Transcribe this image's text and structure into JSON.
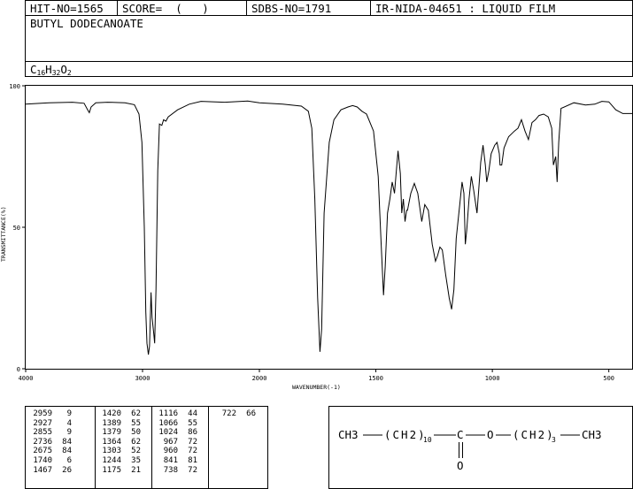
{
  "header": {
    "hit_no": "HIT-NO=1565",
    "score": "SCORE=  (   )",
    "sdbs_no": "SDBS-NO=1791",
    "ir_id": "IR-NIDA-04651 : LIQUID FILM"
  },
  "compound": {
    "name": "BUTYL DODECANOATE",
    "formula_parts": [
      "C",
      "16",
      "H",
      "32",
      "O",
      "2"
    ]
  },
  "chart_data": {
    "type": "line",
    "xlabel": "WAVENUMBER(-1)",
    "ylabel": "TRANSMITTANCE(%)",
    "xlim": [
      4000,
      400
    ],
    "ylim": [
      0,
      100
    ],
    "xticks": [
      "4000",
      "3000",
      "2000",
      "1500",
      "1000",
      "500"
    ],
    "xtick_values": [
      4000,
      3000,
      2000,
      1500,
      1000,
      500
    ],
    "yticks": [
      "0",
      "50",
      "100"
    ],
    "ytick_values": [
      0,
      50,
      100
    ],
    "grid": false,
    "series": [
      {
        "points": [
          [
            4000,
            93.5
          ],
          [
            3800,
            94
          ],
          [
            3600,
            94.2
          ],
          [
            3500,
            93.8
          ],
          [
            3470,
            91.5
          ],
          [
            3455,
            90.5
          ],
          [
            3440,
            92.5
          ],
          [
            3400,
            94
          ],
          [
            3300,
            94.2
          ],
          [
            3150,
            94
          ],
          [
            3070,
            93.3
          ],
          [
            3030,
            90
          ],
          [
            3005,
            80
          ],
          [
            2985,
            50
          ],
          [
            2972,
            20
          ],
          [
            2962,
            9
          ],
          [
            2950,
            5
          ],
          [
            2940,
            8
          ],
          [
            2932,
            20
          ],
          [
            2927,
            27
          ],
          [
            2918,
            18
          ],
          [
            2905,
            13
          ],
          [
            2896,
            9
          ],
          [
            2885,
            28
          ],
          [
            2870,
            70
          ],
          [
            2855,
            86.5
          ],
          [
            2835,
            86
          ],
          [
            2820,
            88
          ],
          [
            2800,
            87.5
          ],
          [
            2780,
            89
          ],
          [
            2700,
            91.5
          ],
          [
            2600,
            93.5
          ],
          [
            2500,
            94.5
          ],
          [
            2300,
            94.2
          ],
          [
            2100,
            94.6
          ],
          [
            2000,
            94
          ],
          [
            1900,
            93.5
          ],
          [
            1820,
            92.8
          ],
          [
            1790,
            91
          ],
          [
            1775,
            85
          ],
          [
            1762,
            60
          ],
          [
            1750,
            25
          ],
          [
            1740,
            6
          ],
          [
            1733,
            14
          ],
          [
            1722,
            55
          ],
          [
            1700,
            80
          ],
          [
            1680,
            88
          ],
          [
            1650,
            91.5
          ],
          [
            1620,
            92.5
          ],
          [
            1600,
            93
          ],
          [
            1580,
            92.5
          ],
          [
            1560,
            91
          ],
          [
            1540,
            90
          ],
          [
            1510,
            84
          ],
          [
            1490,
            68
          ],
          [
            1478,
            45
          ],
          [
            1467,
            26
          ],
          [
            1460,
            36
          ],
          [
            1450,
            55
          ],
          [
            1440,
            60
          ],
          [
            1430,
            66
          ],
          [
            1420,
            62
          ],
          [
            1412,
            70
          ],
          [
            1405,
            77
          ],
          [
            1395,
            69
          ],
          [
            1389,
            55
          ],
          [
            1382,
            60
          ],
          [
            1375,
            52
          ],
          [
            1368,
            56
          ],
          [
            1364,
            56
          ],
          [
            1350,
            62
          ],
          [
            1335,
            65.5
          ],
          [
            1320,
            62
          ],
          [
            1303,
            52
          ],
          [
            1290,
            58
          ],
          [
            1275,
            56
          ],
          [
            1258,
            44
          ],
          [
            1244,
            38
          ],
          [
            1235,
            40
          ],
          [
            1225,
            43
          ],
          [
            1215,
            42
          ],
          [
            1200,
            33
          ],
          [
            1185,
            25
          ],
          [
            1175,
            21
          ],
          [
            1165,
            28
          ],
          [
            1155,
            46
          ],
          [
            1140,
            58
          ],
          [
            1130,
            66
          ],
          [
            1122,
            62
          ],
          [
            1116,
            44
          ],
          [
            1110,
            49
          ],
          [
            1100,
            60
          ],
          [
            1090,
            68
          ],
          [
            1080,
            63
          ],
          [
            1066,
            55
          ],
          [
            1058,
            64
          ],
          [
            1050,
            73
          ],
          [
            1040,
            79
          ],
          [
            1030,
            72
          ],
          [
            1024,
            66
          ],
          [
            1015,
            70
          ],
          [
            1005,
            76
          ],
          [
            990,
            79
          ],
          [
            980,
            80
          ],
          [
            970,
            76
          ],
          [
            967,
            72
          ],
          [
            963,
            72
          ],
          [
            960,
            72
          ],
          [
            950,
            78
          ],
          [
            930,
            82
          ],
          [
            905,
            84
          ],
          [
            890,
            85
          ],
          [
            875,
            88
          ],
          [
            860,
            84
          ],
          [
            845,
            81
          ],
          [
            830,
            87
          ],
          [
            815,
            88
          ],
          [
            800,
            89.5
          ],
          [
            780,
            90
          ],
          [
            760,
            89
          ],
          [
            745,
            85
          ],
          [
            738,
            72
          ],
          [
            728,
            75
          ],
          [
            722,
            66
          ],
          [
            715,
            80
          ],
          [
            705,
            92
          ],
          [
            650,
            94
          ],
          [
            600,
            93.2
          ],
          [
            560,
            93.5
          ],
          [
            530,
            94.5
          ],
          [
            500,
            94.3
          ],
          [
            470,
            91.5
          ],
          [
            440,
            90.2
          ],
          [
            400,
            90.2
          ]
        ]
      }
    ]
  },
  "peaks": {
    "rows": [
      [
        [
          "2959",
          "9"
        ],
        [
          "1420",
          "62"
        ],
        [
          "1116",
          "44"
        ],
        [
          "722",
          "66"
        ]
      ],
      [
        [
          "2927",
          "4"
        ],
        [
          "1389",
          "55"
        ],
        [
          "1066",
          "55"
        ]
      ],
      [
        [
          "2855",
          "9"
        ],
        [
          "1379",
          "50"
        ],
        [
          "1024",
          "86"
        ]
      ],
      [
        [
          "2736",
          "84"
        ],
        [
          "1364",
          "62"
        ],
        [
          "967",
          "72"
        ]
      ],
      [
        [
          "2675",
          "84"
        ],
        [
          "1303",
          "52"
        ],
        [
          "960",
          "72"
        ]
      ],
      [
        [
          "1740",
          "6"
        ],
        [
          "1244",
          "35"
        ],
        [
          "841",
          "81"
        ]
      ],
      [
        [
          "1467",
          "26"
        ],
        [
          "1175",
          "21"
        ],
        [
          "738",
          "72"
        ]
      ]
    ]
  },
  "structure": {
    "ch3_left": "CH3",
    "ch2_group": "(CH2)",
    "sub_10": "10",
    "carbon": "C",
    "oxygen": "O",
    "ch2_group_2": "(CH2)",
    "sub_3": "3",
    "ch3_right": "CH3",
    "carbonyl_o": "O"
  }
}
